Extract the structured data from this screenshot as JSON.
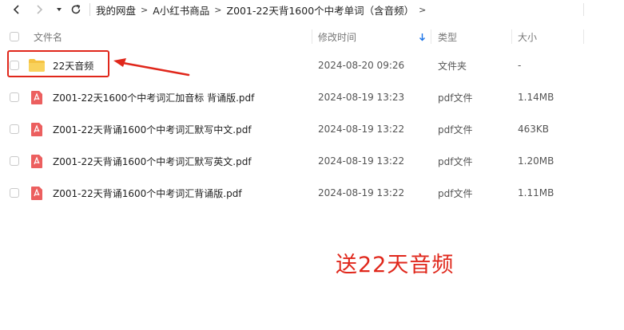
{
  "breadcrumb": {
    "items": [
      "我的网盘",
      "A小红书商品",
      "Z001-22天背1600个中考单词（含音频）"
    ]
  },
  "table": {
    "headers": {
      "name": "文件名",
      "modified": "修改时间",
      "type": "类型",
      "size": "大小"
    },
    "rows": [
      {
        "name": "22天音频",
        "modified": "2024-08-20 09:26",
        "type": "文件夹",
        "size": "-",
        "icon": "folder-icon"
      },
      {
        "name": "Z001-22天1600个中考词汇加音标 背诵版.pdf",
        "modified": "2024-08-19 13:23",
        "type": "pdf文件",
        "size": "1.14MB",
        "icon": "pdf-icon"
      },
      {
        "name": "Z001-22天背诵1600个中考词汇默写中文.pdf",
        "modified": "2024-08-19 13:22",
        "type": "pdf文件",
        "size": "463KB",
        "icon": "pdf-icon"
      },
      {
        "name": "Z001-22天背诵1600个中考词汇默写英文.pdf",
        "modified": "2024-08-19 13:22",
        "type": "pdf文件",
        "size": "1.20MB",
        "icon": "pdf-icon"
      },
      {
        "name": "Z001-22天背诵1600个中考词汇背诵版.pdf",
        "modified": "2024-08-19 13:22",
        "type": "pdf文件",
        "size": "1.11MB",
        "icon": "pdf-icon"
      }
    ]
  },
  "annotation": {
    "promo_text": "送22天音频"
  },
  "colors": {
    "accent": "#1a73e8",
    "annotation_red": "#e0271b",
    "folder": "#f5c342",
    "pdf": "#ec5f5f"
  }
}
